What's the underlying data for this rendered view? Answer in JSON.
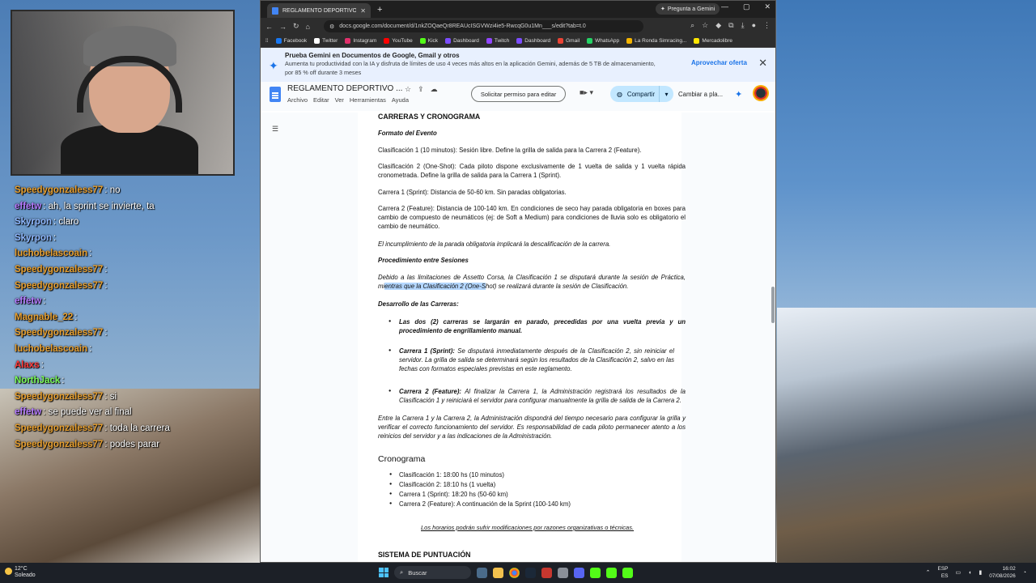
{
  "browser": {
    "tab_title": "REGLAMENTO DEPORTIVO BT...",
    "gemini_pill": "Pregunta a Gemini",
    "url": "docs.google.com/document/d/1nkZOQaeQr8REAUcISGVWzi4ie5-RwcqG0u1Mn___s/edit?tab=t.0",
    "bookmarks": [
      "Facebook",
      "Twitter",
      "Instagram",
      "YouTube",
      "Kick",
      "Dashboard",
      "Twitch",
      "Dashboard",
      "Gmail",
      "WhatsApp",
      "La Ronda Simracing...",
      "Mercadolibre"
    ]
  },
  "promo": {
    "title": "Prueba Gemini en Documentos de Google, Gmail y otros",
    "body": "Aumenta tu productividad con la IA y disfruta de límites de uso 4 veces más altos en la aplicación Gemini, además de 5 TB de almacenamiento, por 85 % off durante 3 meses",
    "offer": "Aprovechar oferta"
  },
  "docs": {
    "title": "REGLAMENTO DEPORTIVO ...",
    "menus": [
      "Archivo",
      "Editar",
      "Ver",
      "Herramientas",
      "Ayuda"
    ],
    "request_edit": "Solicitar permiso para editar",
    "share": "Compartir",
    "change": "Cambiar a pla..."
  },
  "doc": {
    "h1": "CARRERAS Y CRONOGRAMA",
    "formato": "Formato del Evento",
    "p1": "Clasificación 1 (10 minutos): Sesión libre. Define la grilla de salida para la Carrera 2 (Feature).",
    "p2": "Clasificación 2 (One-Shot): Cada piloto dispone exclusivamente de 1 vuelta de salida y 1 vuelta rápida cronometrada. Define la grilla de salida para la Carrera 1 (Sprint).",
    "p3": "Carrera 1 (Sprint): Distancia de 50-60 km. Sin paradas obligatorias.",
    "p4": "Carrera 2 (Feature): Distancia de 100-140 km. En condiciones de seco hay parada obligatoria en boxes para cambio de compuesto de neumáticos (ej: de Soft a Medium) para condiciones de lluvia solo es obligatorio el cambio de neumático.",
    "p5": "El incumplimiento de la parada obligatoria implicará la descalificación de la carrera.",
    "procedimiento": "Procedimiento entre Sesiones",
    "p6a": "Debido a las limitaciones de Assetto Corsa, la Clasificación 1 se disputará durante la sesión de Práctica, mi",
    "p6hl": "entras que la Clasificación 2 (One-S",
    "p6b": "hot) se realizará durante la sesión de Clasificación.",
    "desarrollo": "Desarrollo de las Carreras:",
    "b1": "Las dos (2) carreras se largarán en parado, precedidas por una vuelta previa y un procedimiento de engrillamiento manual.",
    "b2_label": "Carrera 1 (Sprint):",
    "b2": " Se disputará inmediatamente después de la Clasificación 2, sin reiniciar el servidor. La grilla de salida se determinará según los resultados de la Clasificación 2, salvo en las fechas con formatos especiales previstas en este reglamento.",
    "b3_label": "Carrera 2 (Feature):",
    "b3": " Al finalizar la Carrera 1, la Administración registrará los resultados de la Clasificación 1 y reiniciará el servidor para configurar manualmente la grilla de salida de la Carrera 2.",
    "p7": "Entre la Carrera 1 y la Carrera 2, la Administración dispondrá del tiempo necesario para configurar la grilla y verificar el correcto funcionamiento del servidor. Es responsabilidad de cada piloto permanecer atento a los reinicios del servidor y a las indicaciones de la Administración.",
    "cronograma": "Cronograma",
    "sched": [
      "Clasificación 1: 18:00 hs (10 minutos)",
      "Clasificación 2: 18:10 hs (1 vuelta)",
      "Carrera 1 (Sprint): 18:20 hs (50-60 km)",
      "Carrera 2 (Feature): A continuación de la Sprint (100-140 km)"
    ],
    "footnote": "Los horarios podrán sufrir modificaciones por razones organizativas o técnicas.",
    "sistema": "SISTEMA DE PUNTUACIÓN"
  },
  "chat": [
    {
      "user": "Speedygonzaless77",
      "msg": ": no",
      "color": "#e8a030"
    },
    {
      "user": "effetw",
      "msg": ": ah, la sprint se invierte, ta",
      "color": "#b57cff"
    },
    {
      "user": "Skyrpon",
      "msg": ": claro",
      "color": "#8fb8ff"
    },
    {
      "user": "Skyrpon",
      "msg": ":",
      "color": "#8fb8ff"
    },
    {
      "user": "luchobelascoain",
      "msg": ":",
      "color": "#e8a030"
    },
    {
      "user": "Speedygonzaless77",
      "msg": ":",
      "color": "#e8a030"
    },
    {
      "user": "Speedygonzaless77",
      "msg": ":",
      "color": "#e8a030"
    },
    {
      "user": "effetw",
      "msg": ":",
      "color": "#b57cff"
    },
    {
      "user": "Magnable_22",
      "msg": ":",
      "color": "#e8a030"
    },
    {
      "user": "Speedygonzaless77",
      "msg": ":",
      "color": "#e8a030"
    },
    {
      "user": "luchobelascoain",
      "msg": ":",
      "color": "#e8a030"
    },
    {
      "user": "Alaxs",
      "msg": ":",
      "color": "#ff3b3b"
    },
    {
      "user": "NorthJack",
      "msg": ":",
      "color": "#7cff5a"
    },
    {
      "user": "Speedygonzaless77",
      "msg": ": si",
      "color": "#e8a030"
    },
    {
      "user": "effetw",
      "msg": ": se puede ver al final",
      "color": "#b57cff"
    },
    {
      "user": "Speedygonzaless77",
      "msg": ": toda la carrera",
      "color": "#e8a030"
    },
    {
      "user": "Speedygonzaless77",
      "msg": ": podes parar",
      "color": "#e8a030"
    }
  ],
  "taskbar": {
    "temp": "12°C",
    "weather": "Soleado",
    "search": "Buscar",
    "lang1": "ESP",
    "lang2": "ES",
    "time": "16:02",
    "date": "07/08/2026"
  }
}
